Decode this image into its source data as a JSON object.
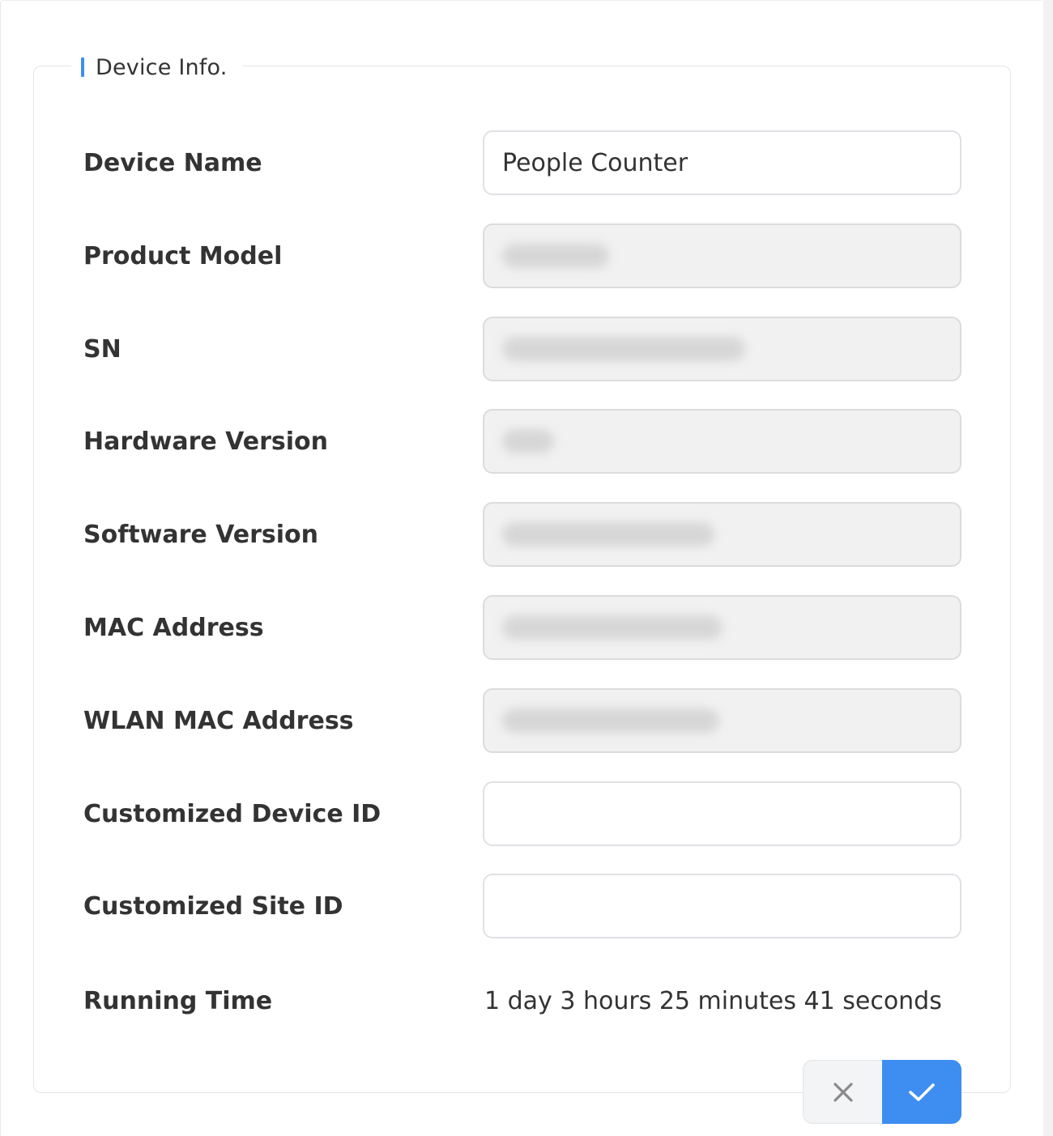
{
  "section": {
    "title": "Device Info."
  },
  "fields": [
    {
      "label": "Device Name",
      "value": "People Counter"
    },
    {
      "label": "Product Model"
    },
    {
      "label": "SN"
    },
    {
      "label": "Hardware Version"
    },
    {
      "label": "Software Version"
    },
    {
      "label": "MAC Address"
    },
    {
      "label": "WLAN MAC Address"
    },
    {
      "label": "Customized Device ID",
      "value": ""
    },
    {
      "label": "Customized Site ID",
      "value": ""
    },
    {
      "label": "Running Time",
      "value": "1 day 3 hours 25 minutes 41 seconds"
    }
  ],
  "buttons": {
    "cancel_icon": "close-icon",
    "confirm_icon": "check-icon"
  },
  "colors": {
    "accent": "#3d8ef0",
    "disabled_bg": "#f1f1f1",
    "text": "#333333"
  }
}
